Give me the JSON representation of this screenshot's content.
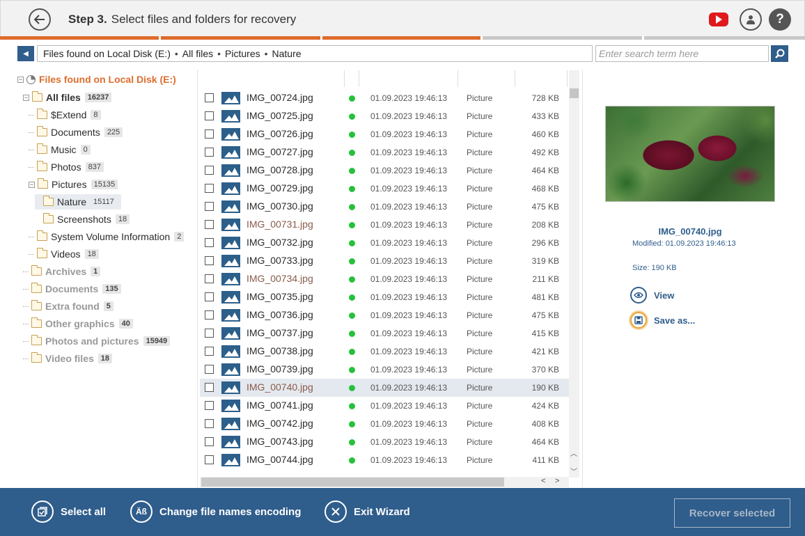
{
  "header": {
    "step": "Step 3.",
    "title": "Select files and folders for recovery"
  },
  "progress": {
    "completed_steps": 3,
    "total_steps": 5
  },
  "path": {
    "segments": [
      "Files found on Local Disk (E:)",
      "All files",
      "Pictures",
      "Nature"
    ],
    "separator": "•"
  },
  "search": {
    "placeholder": "Enter search term here"
  },
  "tree": {
    "root": "Files found on Local Disk (E:)",
    "all_files": {
      "label": "All files",
      "count": "16237"
    },
    "children": [
      {
        "label": "$Extend",
        "count": "8"
      },
      {
        "label": "Documents",
        "count": "225"
      },
      {
        "label": "Music",
        "count": "0"
      },
      {
        "label": "Photos",
        "count": "837"
      },
      {
        "label": "Pictures",
        "count": "15135"
      },
      {
        "label": "Nature",
        "count": "15117"
      },
      {
        "label": "Screenshots",
        "count": "18"
      },
      {
        "label": "System Volume Information",
        "count": "2"
      },
      {
        "label": "Videos",
        "count": "18"
      }
    ],
    "groups": [
      {
        "label": "Archives",
        "count": "1"
      },
      {
        "label": "Documents",
        "count": "135"
      },
      {
        "label": "Extra found",
        "count": "5"
      },
      {
        "label": "Other graphics",
        "count": "40"
      },
      {
        "label": "Photos and pictures",
        "count": "15949"
      },
      {
        "label": "Video files",
        "count": "18"
      }
    ]
  },
  "files": [
    {
      "name": "IMG_00724.jpg",
      "date": "01.09.2023 19:46:13",
      "type": "Picture",
      "size": "728 KB"
    },
    {
      "name": "IMG_00725.jpg",
      "date": "01.09.2023 19:46:13",
      "type": "Picture",
      "size": "433 KB"
    },
    {
      "name": "IMG_00726.jpg",
      "date": "01.09.2023 19:46:13",
      "type": "Picture",
      "size": "460 KB"
    },
    {
      "name": "IMG_00727.jpg",
      "date": "01.09.2023 19:46:13",
      "type": "Picture",
      "size": "492 KB"
    },
    {
      "name": "IMG_00728.jpg",
      "date": "01.09.2023 19:46:13",
      "type": "Picture",
      "size": "464 KB"
    },
    {
      "name": "IMG_00729.jpg",
      "date": "01.09.2023 19:46:13",
      "type": "Picture",
      "size": "468 KB"
    },
    {
      "name": "IMG_00730.jpg",
      "date": "01.09.2023 19:46:13",
      "type": "Picture",
      "size": "475 KB"
    },
    {
      "name": "IMG_00731.jpg",
      "date": "01.09.2023 19:46:13",
      "type": "Picture",
      "size": "208 KB"
    },
    {
      "name": "IMG_00732.jpg",
      "date": "01.09.2023 19:46:13",
      "type": "Picture",
      "size": "296 KB"
    },
    {
      "name": "IMG_00733.jpg",
      "date": "01.09.2023 19:46:13",
      "type": "Picture",
      "size": "319 KB"
    },
    {
      "name": "IMG_00734.jpg",
      "date": "01.09.2023 19:46:13",
      "type": "Picture",
      "size": "211 KB"
    },
    {
      "name": "IMG_00735.jpg",
      "date": "01.09.2023 19:46:13",
      "type": "Picture",
      "size": "481 KB"
    },
    {
      "name": "IMG_00736.jpg",
      "date": "01.09.2023 19:46:13",
      "type": "Picture",
      "size": "475 KB"
    },
    {
      "name": "IMG_00737.jpg",
      "date": "01.09.2023 19:46:13",
      "type": "Picture",
      "size": "415 KB"
    },
    {
      "name": "IMG_00738.jpg",
      "date": "01.09.2023 19:46:13",
      "type": "Picture",
      "size": "421 KB"
    },
    {
      "name": "IMG_00739.jpg",
      "date": "01.09.2023 19:46:13",
      "type": "Picture",
      "size": "370 KB"
    },
    {
      "name": "IMG_00740.jpg",
      "date": "01.09.2023 19:46:13",
      "type": "Picture",
      "size": "190 KB"
    },
    {
      "name": "IMG_00741.jpg",
      "date": "01.09.2023 19:46:13",
      "type": "Picture",
      "size": "424 KB"
    },
    {
      "name": "IMG_00742.jpg",
      "date": "01.09.2023 19:46:13",
      "type": "Picture",
      "size": "408 KB"
    },
    {
      "name": "IMG_00743.jpg",
      "date": "01.09.2023 19:46:13",
      "type": "Picture",
      "size": "464 KB"
    },
    {
      "name": "IMG_00744.jpg",
      "date": "01.09.2023 19:46:13",
      "type": "Picture",
      "size": "411 KB"
    }
  ],
  "preview": {
    "name": "IMG_00740.jpg",
    "modified": "Modified: 01.09.2023 19:46:13",
    "size": "Size: 190 KB",
    "view_label": "View",
    "save_label": "Save as..."
  },
  "footer": {
    "select_all": "Select all",
    "encoding": "Change file names encoding",
    "encoding_icon_text": "Äß",
    "exit": "Exit Wizard",
    "recover": "Recover selected"
  },
  "colors": {
    "accent": "#2f5d8c",
    "progress": "#dd6d2d",
    "status_ok": "#25c13a",
    "highlight_name": "#8a5a4a"
  }
}
